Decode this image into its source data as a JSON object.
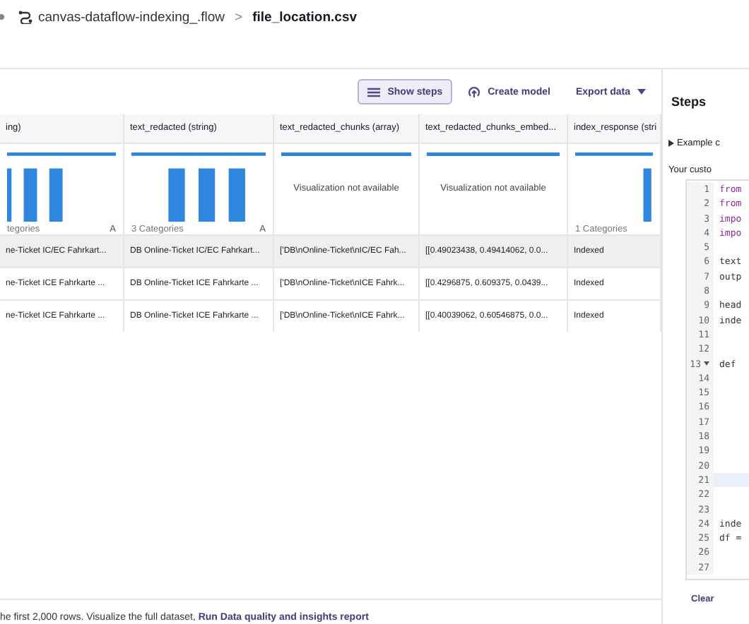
{
  "breadcrumb": {
    "flow": "canvas-dataflow-indexing_.flow",
    "separator": ">",
    "file": "file_location.csv"
  },
  "toolbar": [
    {
      "label": "Show steps",
      "kind": "toggle",
      "selected": true
    },
    {
      "label": "Create model",
      "kind": "action",
      "selected": false
    },
    {
      "label": "Export data",
      "kind": "dropdown",
      "selected": false
    }
  ],
  "table": {
    "columns": [
      {
        "header": "ing)",
        "kind": "histogram",
        "summary": "tegories",
        "type_icon": "A"
      },
      {
        "header": "text_redacted (string)",
        "kind": "histogram",
        "summary": "3 Categories",
        "type_icon": "A"
      },
      {
        "header": "text_redacted_chunks (array)",
        "kind": "unavailable",
        "message": "Visualization not available"
      },
      {
        "header": "text_redacted_chunks_embed...",
        "kind": "unavailable",
        "message": "Visualization not available"
      },
      {
        "header": "index_response (stri",
        "kind": "histogram",
        "summary": "1 Categories"
      }
    ],
    "rows": [
      {
        "selected": true,
        "cells": [
          "ne-Ticket IC/EC Fahrkart...",
          "DB Online-Ticket IC/EC Fahrkart...",
          "['DB\\nOnline-Ticket\\nIC/EC Fah...",
          "[[0.49023438, 0.49414062, 0.0...",
          "Indexed"
        ]
      },
      {
        "selected": false,
        "cells": [
          "ne-Ticket ICE Fahrkarte ...",
          "DB Online-Ticket ICE Fahrkarte ...",
          "['DB\\nOnline-Ticket\\nICE Fahrk...",
          "[[0.4296875, 0.609375, 0.0439...",
          "Indexed"
        ]
      },
      {
        "selected": false,
        "cells": [
          "ne-Ticket ICE Fahrkarte ...",
          "DB Online-Ticket ICE Fahrkarte ...",
          "['DB\\nOnline-Ticket\\nICE Fahrk...",
          "[[0.40039062, 0.60546875, 0.0...",
          "Indexed"
        ]
      }
    ]
  },
  "footer": {
    "text": "he first 2,000 rows. Visualize the full dataset, ",
    "link": "Run Data quality and insights report"
  },
  "steps_panel": {
    "title": "Steps",
    "example": "Example c",
    "expanded": false,
    "prompt": "Your custo",
    "code_lines": [
      {
        "number": "1",
        "code": "from",
        "highlighted": false,
        "foldable": false
      },
      {
        "number": "2",
        "code": "from",
        "highlighted": false,
        "foldable": false
      },
      {
        "number": "3",
        "code": "impo",
        "highlighted": false,
        "foldable": false
      },
      {
        "number": "4",
        "code": "impo",
        "highlighted": false,
        "foldable": false
      },
      {
        "number": "5",
        "highlighted": false,
        "foldable": false
      },
      {
        "number": "6",
        "code": "text",
        "highlighted": false,
        "foldable": false
      },
      {
        "number": "7",
        "code": "outp",
        "highlighted": false,
        "foldable": false
      },
      {
        "number": "8",
        "highlighted": false,
        "foldable": false
      },
      {
        "number": "9",
        "code": "head",
        "highlighted": false,
        "foldable": false
      },
      {
        "number": "10",
        "code": "inde",
        "highlighted": false,
        "foldable": false
      },
      {
        "number": "11",
        "highlighted": false,
        "foldable": false
      },
      {
        "number": "12",
        "highlighted": false,
        "foldable": false
      },
      {
        "number": "13",
        "code": "def",
        "highlighted": false,
        "foldable": true
      },
      {
        "number": "14",
        "highlighted": false,
        "foldable": false
      },
      {
        "number": "15",
        "highlighted": false,
        "foldable": false
      },
      {
        "number": "16",
        "highlighted": false,
        "foldable": false
      },
      {
        "number": "17",
        "highlighted": false,
        "foldable": false
      },
      {
        "number": "18",
        "highlighted": false,
        "foldable": false
      },
      {
        "number": "19",
        "highlighted": false,
        "foldable": false
      },
      {
        "number": "20",
        "highlighted": false,
        "foldable": false
      },
      {
        "number": "21",
        "highlighted": true,
        "foldable": false
      },
      {
        "number": "22",
        "highlighted": false,
        "foldable": false
      },
      {
        "number": "23",
        "highlighted": false,
        "foldable": false
      },
      {
        "number": "24",
        "code": "inde",
        "highlighted": false,
        "foldable": false
      },
      {
        "number": "25",
        "code": "df =",
        "highlighted": false,
        "foldable": false
      },
      {
        "number": "26",
        "highlighted": false,
        "foldable": false
      },
      {
        "number": "27",
        "highlighted": false,
        "foldable": false
      }
    ],
    "clear_button": "Clear"
  }
}
